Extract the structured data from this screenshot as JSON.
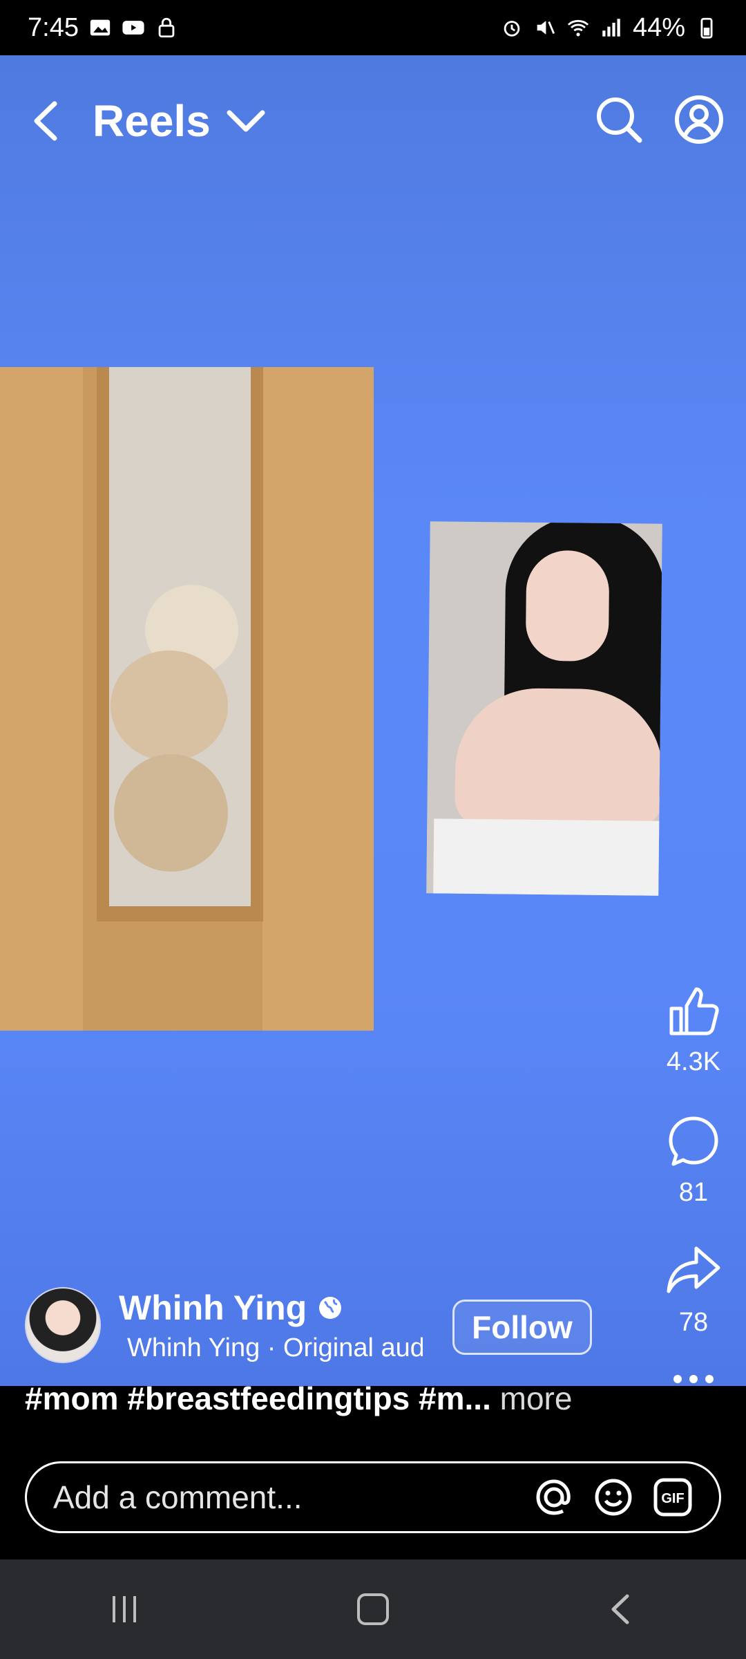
{
  "status_bar": {
    "time": "7:45",
    "battery": "44%"
  },
  "header": {
    "title": "Reels"
  },
  "actions": {
    "like_count": "4.3K",
    "comment_count": "81",
    "share_count": "78"
  },
  "post": {
    "author_name": "Whinh Ying",
    "audio_text": "Whinh Ying · Original audio",
    "follow_label": "Follow",
    "caption_tags": "#mom #breastfeedingtips #m...",
    "more_label": "more"
  },
  "comment": {
    "placeholder": "Add a comment..."
  },
  "colors": {
    "reel_background": "#5b88f7",
    "navbar": "#2a2b2f"
  }
}
